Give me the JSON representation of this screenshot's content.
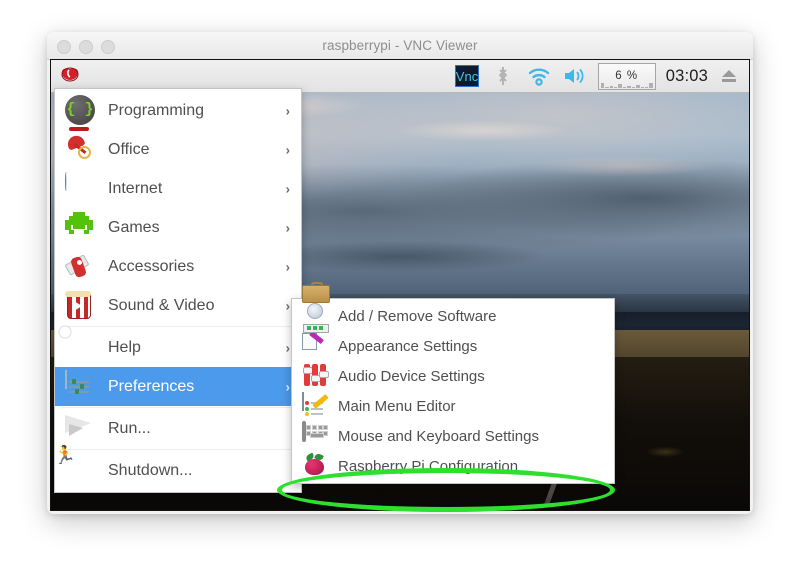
{
  "window": {
    "title": "raspberrypi - VNC Viewer",
    "traffic_lights": [
      "close",
      "minimize",
      "zoom"
    ]
  },
  "taskbar": {
    "launcher_icon": "raspberry-pi-logo",
    "tray": [
      {
        "name": "vnc-icon",
        "label": "VNC"
      },
      {
        "name": "bluetooth-icon",
        "label": ""
      },
      {
        "name": "wifi-icon",
        "label": ""
      },
      {
        "name": "volume-icon",
        "label": ""
      }
    ],
    "cpu_meter": {
      "value": "6",
      "unit": "%",
      "label": "6 %"
    },
    "clock": "03:03",
    "eject_icon": "eject-icon"
  },
  "main_menu": {
    "items": [
      {
        "label": "Programming",
        "icon": "programming-icon",
        "arrow": "›",
        "selected": false
      },
      {
        "label": "Office",
        "icon": "office-icon",
        "arrow": "›",
        "selected": false
      },
      {
        "label": "Internet",
        "icon": "internet-icon",
        "arrow": "›",
        "selected": false
      },
      {
        "label": "Games",
        "icon": "games-icon",
        "arrow": "›",
        "selected": false
      },
      {
        "label": "Accessories",
        "icon": "accessories-icon",
        "arrow": "›",
        "selected": false
      },
      {
        "label": "Sound & Video",
        "icon": "sound-video-icon",
        "arrow": "›",
        "selected": false
      },
      {
        "label": "Help",
        "icon": "help-icon",
        "arrow": "›",
        "selected": false
      },
      {
        "label": "Preferences",
        "icon": "preferences-icon",
        "arrow": "›",
        "selected": true
      },
      {
        "label": "Run...",
        "icon": "run-icon",
        "arrow": "",
        "selected": false
      },
      {
        "label": "Shutdown...",
        "icon": "shutdown-icon",
        "arrow": "",
        "selected": false
      }
    ]
  },
  "sub_menu": {
    "items": [
      {
        "label": "Add / Remove Software",
        "icon": "add-remove-software-icon"
      },
      {
        "label": "Appearance Settings",
        "icon": "appearance-settings-icon"
      },
      {
        "label": "Audio Device Settings",
        "icon": "audio-device-settings-icon"
      },
      {
        "label": "Main Menu Editor",
        "icon": "main-menu-editor-icon"
      },
      {
        "label": "Mouse and Keyboard Settings",
        "icon": "mouse-keyboard-settings-icon"
      },
      {
        "label": "Raspberry Pi Configuration",
        "icon": "raspberry-pi-configuration-icon"
      }
    ]
  },
  "annotation": {
    "highlight_color": "#2ee02e",
    "target_label": "Raspberry Pi Configuration"
  },
  "colors": {
    "selection_blue": "#4c9aeb",
    "menu_background": "#ffffff",
    "menu_text": "#4f4f4f",
    "taskbar_background": "#ebebeb",
    "titlebar_text": "#8e8e8e"
  }
}
